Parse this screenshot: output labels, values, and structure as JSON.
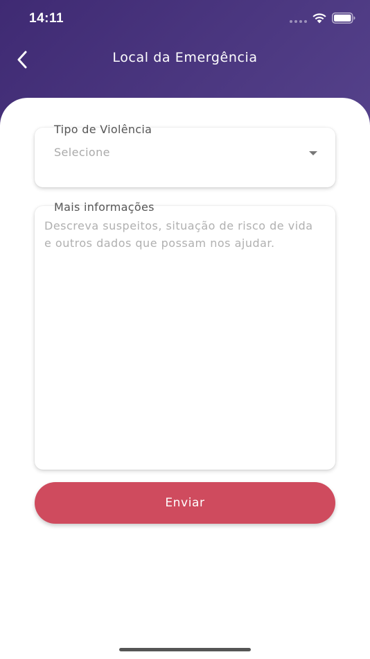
{
  "status_bar": {
    "time": "14:11"
  },
  "header": {
    "title": "Local da Emergência"
  },
  "form": {
    "violence_type": {
      "label": "Tipo de Violência",
      "value": "Selecione"
    },
    "more_info": {
      "label": "Mais informações",
      "placeholder": "Descreva suspeitos, situação de risco de vida e outros dados que possam nos ajudar."
    },
    "submit_label": "Enviar"
  },
  "colors": {
    "header_gradient_start": "#3f2a73",
    "header_gradient_end": "#6a5aa0",
    "submit_button": "#cf4b5e"
  },
  "icons": {
    "back": "chevron-left-icon",
    "wifi": "wifi-icon",
    "battery": "battery-icon",
    "dropdown": "caret-down-icon"
  }
}
